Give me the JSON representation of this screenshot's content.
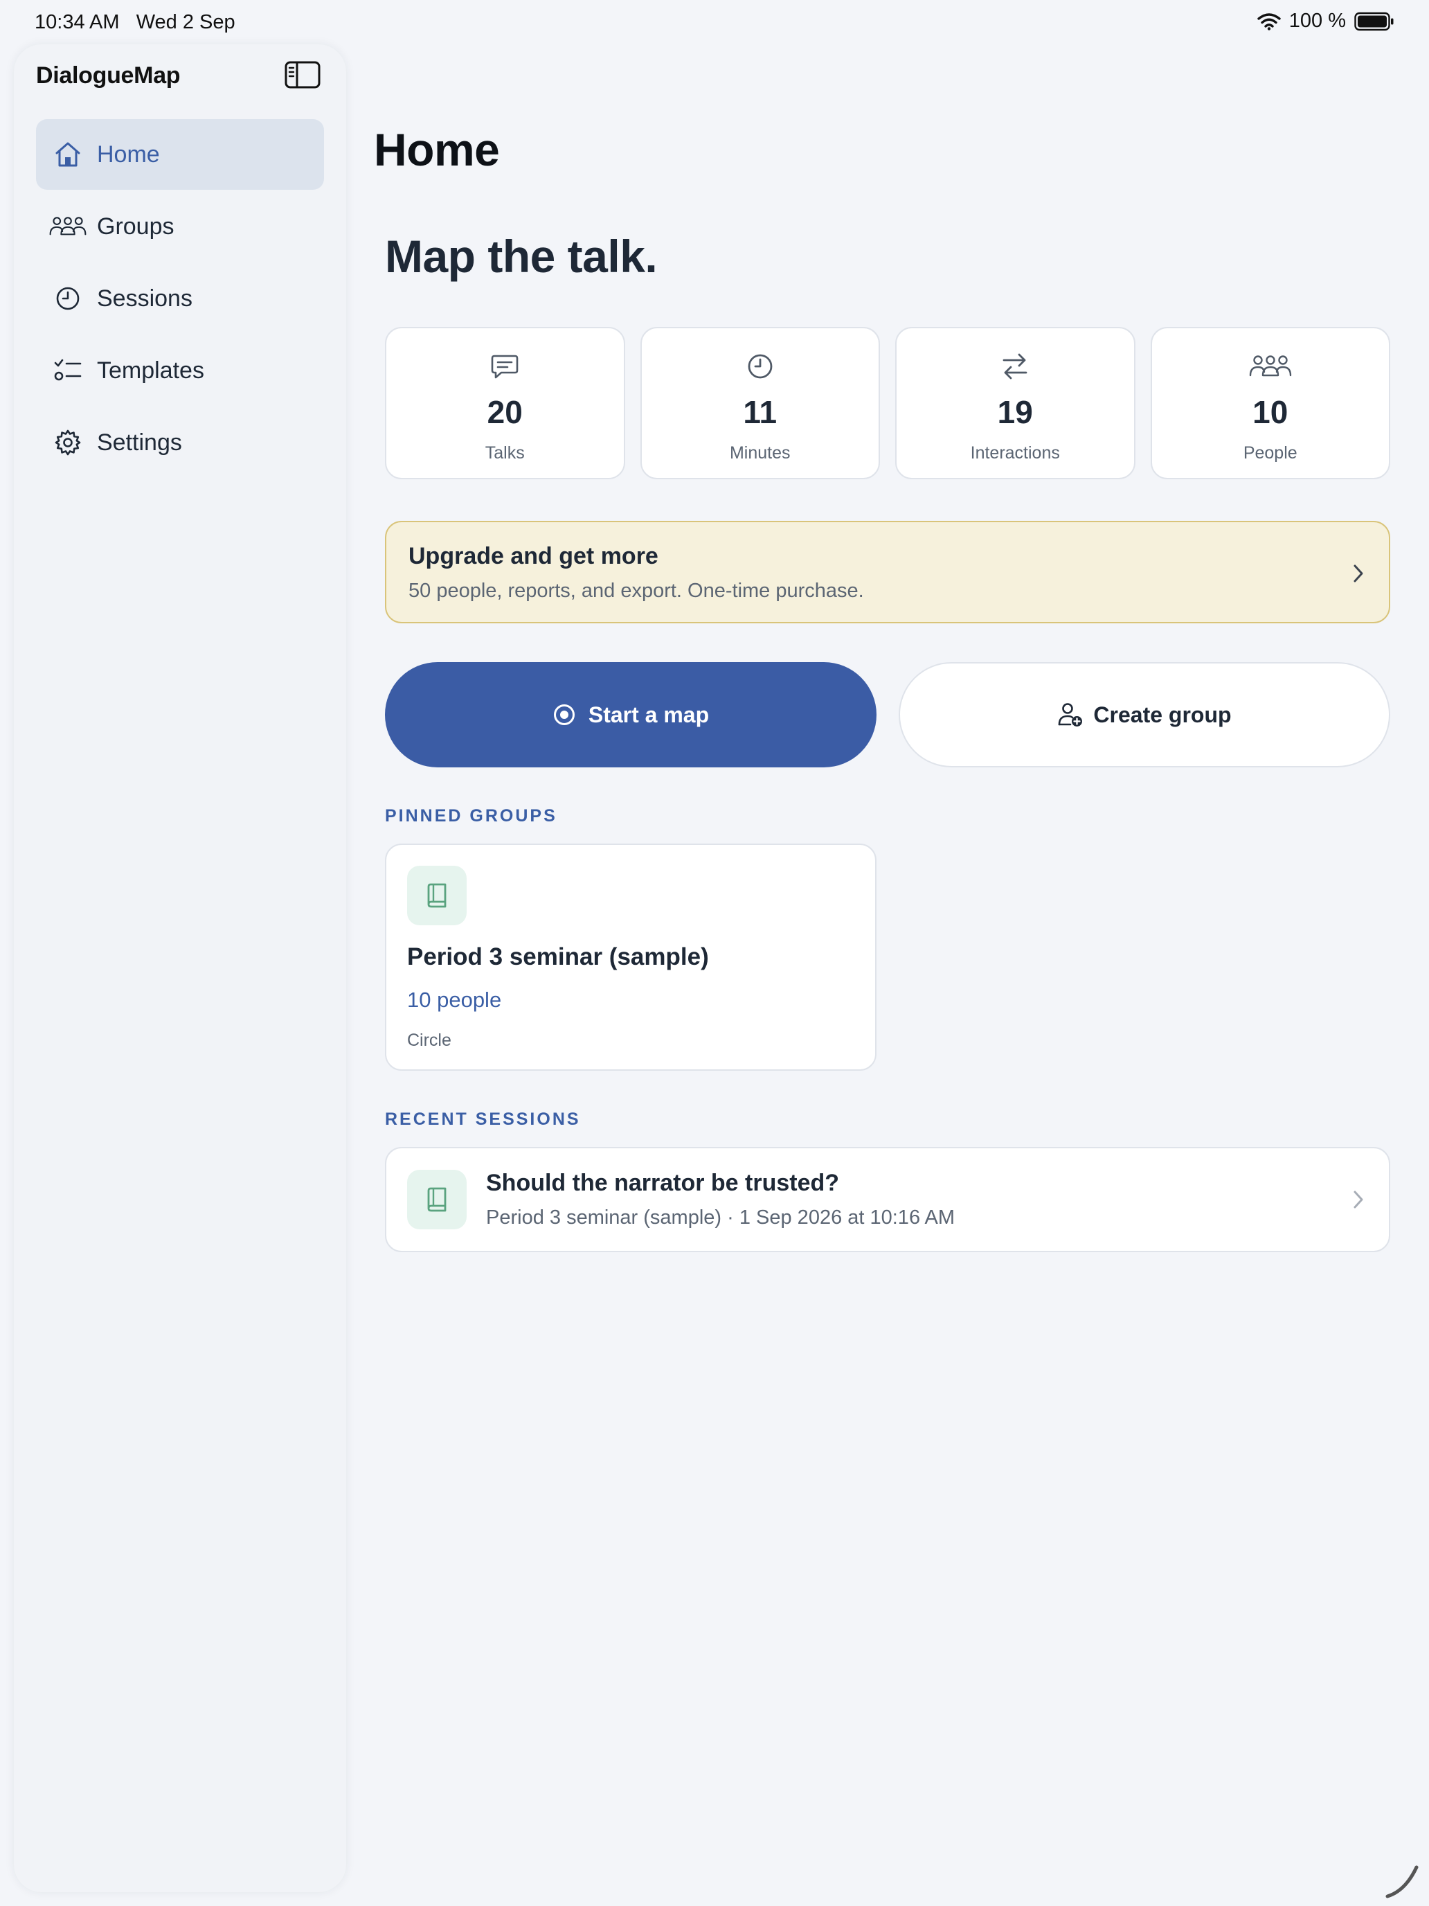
{
  "status": {
    "time": "10:34 AM",
    "date": "Wed 2 Sep",
    "battery": "100 %"
  },
  "sidebar": {
    "app_title": "DialogueMap",
    "items": [
      {
        "label": "Home",
        "icon": "house-icon",
        "active": true
      },
      {
        "label": "Groups",
        "icon": "people-icon",
        "active": false
      },
      {
        "label": "Sessions",
        "icon": "clock-icon",
        "active": false
      },
      {
        "label": "Templates",
        "icon": "checklist-icon",
        "active": false
      },
      {
        "label": "Settings",
        "icon": "gear-icon",
        "active": false
      }
    ]
  },
  "main": {
    "title": "Home",
    "hero": "Map the talk.",
    "stats": [
      {
        "value": "20",
        "label": "Talks",
        "icon": "chat-icon"
      },
      {
        "value": "11",
        "label": "Minutes",
        "icon": "clock-icon"
      },
      {
        "value": "19",
        "label": "Interactions",
        "icon": "arrows-icon"
      },
      {
        "value": "10",
        "label": "People",
        "icon": "people-icon"
      }
    ],
    "upgrade": {
      "title": "Upgrade and get more",
      "subtitle": "50 people, reports, and export. One-time purchase."
    },
    "actions": {
      "start_map": "Start a map",
      "create_group": "Create group"
    },
    "pinned_label": "PINNED GROUPS",
    "pinned_group": {
      "name": "Period 3 seminar (sample)",
      "people": "10 people",
      "layout": "Circle",
      "icon": "book-icon"
    },
    "recent_label": "RECENT SESSIONS",
    "recent_session": {
      "title": "Should the narrator be trusted?",
      "meta": "Period 3 seminar (sample)  ·  1 Sep 2026 at 10:16 AM",
      "icon": "book-icon"
    }
  },
  "colors": {
    "accent": "#3b5ca5",
    "background": "#f3f5f9",
    "upgrade_bg": "#f6f1dc",
    "badge_green": "#5aa37f"
  }
}
